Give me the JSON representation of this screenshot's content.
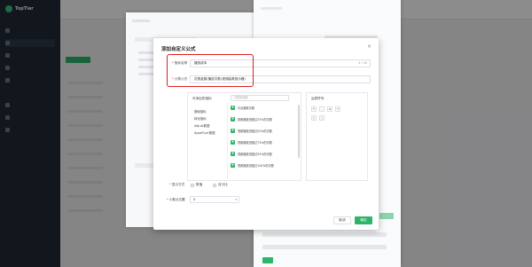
{
  "app": {
    "name": "TopTier"
  },
  "sidebar": {
    "items": [
      "",
      "",
      "",
      "",
      "",
      "",
      "",
      "",
      ""
    ]
  },
  "modal": {
    "title": "添加自定义公式",
    "close_icon": "close-icon",
    "name_label": "指标名称",
    "name_value": "播放成本",
    "name_counter": "4 / 30",
    "formula_label": "计算公式",
    "formula_value": "花费金额/播放次数(视频曲数指示器)",
    "metrics_panel": {
      "header": "可添加的指标",
      "search_placeholder": "请搜索指标",
      "categories": [
        "基础指标",
        "转化指标",
        "Adjust数据",
        "AppsFlyer数据"
      ],
      "metrics": [
        "平台播放次数",
        "视频播放进度达25%的次数",
        "视频播放进度达50%的次数",
        "视频播放进度达75%的次数",
        "视频播放进度达95%的次数",
        "视频播放进度达100%的次数"
      ]
    },
    "operators": {
      "header": "运算符号",
      "symbols": [
        "+",
        "-",
        "×",
        "÷",
        "(",
        ")"
      ]
    },
    "display": {
      "label": "显示方式",
      "options": [
        "数值",
        "百分比"
      ]
    },
    "decimal": {
      "label": "小数点位置",
      "value": "0"
    },
    "cancel_label": "取消",
    "ok_label": "确定"
  },
  "colors": {
    "accent": "#2fb56a",
    "highlight": "#e02020",
    "sidebar": "#1f2a36"
  }
}
